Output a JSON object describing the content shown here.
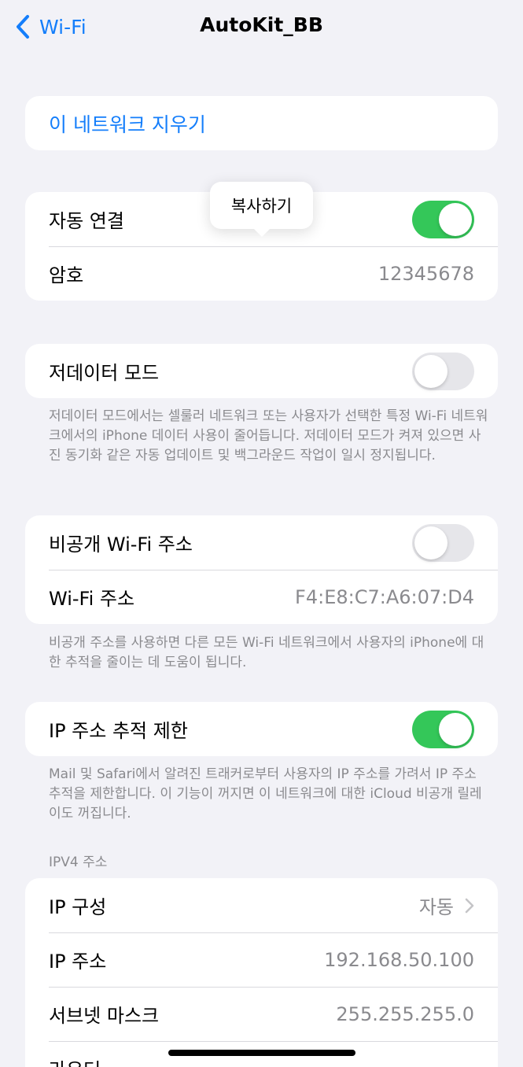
{
  "nav": {
    "back_label": "Wi-Fi",
    "title": "AutoKit_BB"
  },
  "forget": {
    "label": "이 네트워크 지우기"
  },
  "auto_join": {
    "label": "자동 연결",
    "on": true
  },
  "password": {
    "label": "암호",
    "value": "12345678"
  },
  "popup": {
    "label": "복사하기"
  },
  "low_data": {
    "label": "저데이터 모드",
    "on": false,
    "note": "저데이터 모드에서는 셀룰러 네트워크 또는 사용자가 선택한 특정 Wi-Fi 네트워크에서의 iPhone 데이터 사용이 줄어듭니다. 저데이터 모드가 켜져 있으면 사진 동기화 같은 자동 업데이트 및 백그라운드 작업이 일시 정지됩니다."
  },
  "private_addr": {
    "label": "비공개 Wi-Fi 주소",
    "on": false,
    "wifi_label": "Wi-Fi 주소",
    "wifi_value": "F4:E8:C7:A6:07:D4",
    "note": "비공개 주소를 사용하면 다른 모든 Wi-Fi 네트워크에서 사용자의 iPhone에 대한 추적을 줄이는 데 도움이 됩니다."
  },
  "ip_tracking": {
    "label": "IP 주소 추적 제한",
    "on": true,
    "note": "Mail 및 Safari에서 알려진 트래커로부터 사용자의 IP 주소를 가려서 IP 주소 추적을 제한합니다. 이 기능이 꺼지면 이 네트워크에 대한 iCloud 비공개 릴레이도 꺼집니다."
  },
  "ipv4": {
    "header": "IPV4 주소",
    "config_label": "IP 구성",
    "config_value": "자동",
    "ip_label": "IP 주소",
    "ip_value": "192.168.50.100",
    "subnet_label": "서브넷 마스크",
    "subnet_value": "255.255.255.0",
    "router_label": "라우터"
  },
  "colors": {
    "accent": "#147efb",
    "toggle_on": "#34c759",
    "secondary_text": "#8a8a8e",
    "background": "#f2f2f7"
  }
}
